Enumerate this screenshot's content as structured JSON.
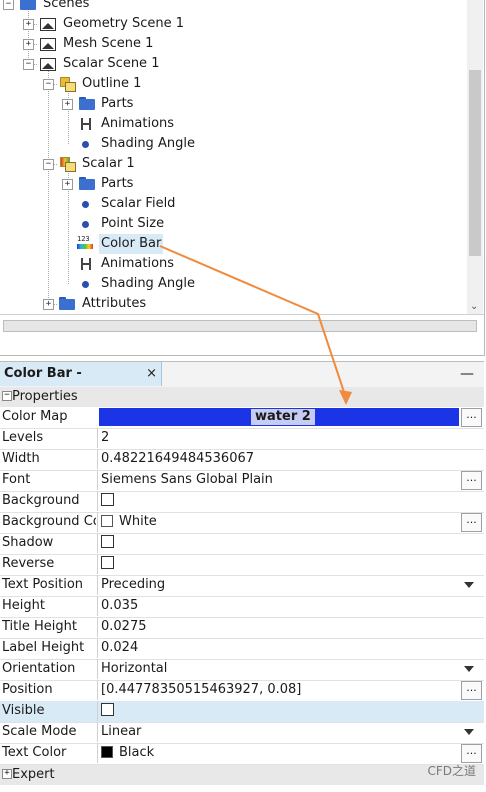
{
  "tree": {
    "items": [
      {
        "label": "Scenes"
      },
      {
        "label": "Geometry Scene 1"
      },
      {
        "label": "Mesh Scene 1"
      },
      {
        "label": "Scalar Scene 1"
      },
      {
        "label": "Outline 1"
      },
      {
        "label": "Parts"
      },
      {
        "label": "Animations"
      },
      {
        "label": "Shading Angle"
      },
      {
        "label": "Scalar 1"
      },
      {
        "label": "Parts"
      },
      {
        "label": "Scalar Field"
      },
      {
        "label": "Point Size"
      },
      {
        "label": "Color Bar"
      },
      {
        "label": "Animations"
      },
      {
        "label": "Shading Angle"
      },
      {
        "label": "Attributes"
      }
    ],
    "color_bar_icon_digits": "123"
  },
  "properties_panel": {
    "tab_title": "Color Bar - Properties",
    "tab_close": "×",
    "minimize": "—",
    "section_properties": "Properties",
    "section_expert": "Expert",
    "collapse_glyph": "−",
    "expand_glyph": "+",
    "ellipsis": "...",
    "rows": {
      "color_map": {
        "name": "Color Map",
        "value": "water 2",
        "bar_color": "#1a34e6"
      },
      "levels": {
        "name": "Levels",
        "value": "2"
      },
      "width": {
        "name": "Width",
        "value": "0.48221649484536067"
      },
      "font": {
        "name": "Font",
        "value": "Siemens Sans Global Plain"
      },
      "background": {
        "name": "Background"
      },
      "background_color": {
        "name": "Background Col",
        "value": "White",
        "swatch": "#ffffff"
      },
      "shadow": {
        "name": "Shadow"
      },
      "reverse": {
        "name": "Reverse"
      },
      "text_position": {
        "name": "Text Position",
        "value": "Preceding"
      },
      "height": {
        "name": "Height",
        "value": "0.035"
      },
      "title_height": {
        "name": "Title Height",
        "value": "0.0275"
      },
      "label_height": {
        "name": "Label Height",
        "value": "0.024"
      },
      "orientation": {
        "name": "Orientation",
        "value": "Horizontal"
      },
      "position": {
        "name": "Position",
        "value": "[0.44778350515463927, 0.08]"
      },
      "visible": {
        "name": "Visible"
      },
      "scale_mode": {
        "name": "Scale Mode",
        "value": "Linear"
      },
      "text_color": {
        "name": "Text Color",
        "value": "Black",
        "swatch": "#000000"
      }
    }
  },
  "colors": {
    "selection": "#d9eaf7",
    "annotation_arrow": "#f08a3c",
    "folder": "#3b6fd0"
  },
  "watermark": "CFD之道"
}
